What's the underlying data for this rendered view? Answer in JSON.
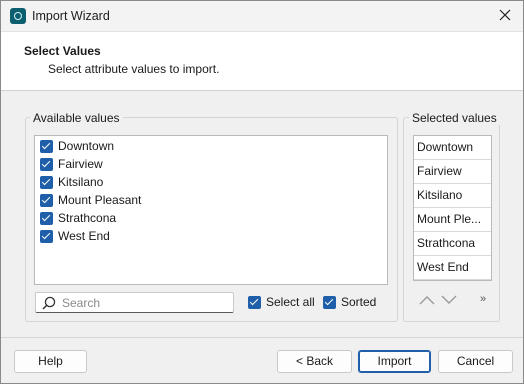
{
  "window": {
    "title": "Import Wizard"
  },
  "header": {
    "title": "Select Values",
    "subtitle": "Select attribute values to import."
  },
  "available": {
    "label": "Available values",
    "items": [
      {
        "label": "Downtown",
        "checked": true
      },
      {
        "label": "Fairview",
        "checked": true
      },
      {
        "label": "Kitsilano",
        "checked": true
      },
      {
        "label": "Mount Pleasant",
        "checked": true
      },
      {
        "label": "Strathcona",
        "checked": true
      },
      {
        "label": "West End",
        "checked": true
      }
    ],
    "search_placeholder": "Search",
    "select_all_label": "Select all",
    "select_all_checked": true,
    "sorted_label": "Sorted",
    "sorted_checked": true
  },
  "selected": {
    "label": "Selected values",
    "items": [
      "Downtown",
      "Fairview",
      "Kitsilano",
      "Mount Ple...",
      "Strathcona",
      "West End"
    ],
    "more_label": "»"
  },
  "footer": {
    "help": "Help",
    "back": "< Back",
    "import": "Import",
    "cancel": "Cancel"
  },
  "icons": {
    "app": "app-icon",
    "close": "close-icon",
    "search": "search-icon",
    "up": "chevron-up-icon",
    "down": "chevron-down-icon"
  },
  "colors": {
    "accent": "#1f5fa9",
    "app_icon": "#0b5f6e"
  }
}
